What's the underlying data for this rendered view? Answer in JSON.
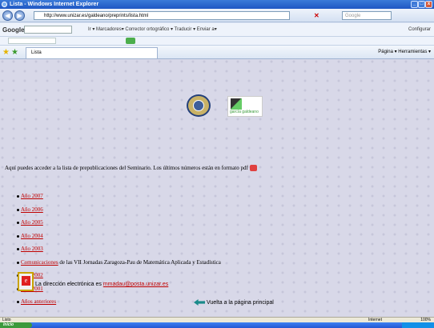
{
  "window": {
    "title": "Lista - Windows Internet Explorer"
  },
  "address": {
    "url": "http://www.unizar.es/galdeano/preprints/lista.html"
  },
  "search": {
    "placeholder": "Google"
  },
  "googlebar": {
    "logo": "Google",
    "items": "Ir ▾  Marcadores▾   Corrector ortográfico ▾   Traducir ▾   Enviar a▾",
    "settings": "Configurar"
  },
  "tab": {
    "title": "Lista"
  },
  "tools": "Página ▾  Herramientas ▾",
  "page": {
    "intro": "Aquí puedes acceder a la lista de prepublicaciones del Seminario. Los últimos números están en formato pdf",
    "logo2_text": "garcía galdeano",
    "list": [
      {
        "link": "Año 2007",
        "rest": ""
      },
      {
        "link": "Año 2006",
        "rest": ""
      },
      {
        "link": "Año 2005",
        "rest": ""
      },
      {
        "link": "Año 2004",
        "rest": ""
      },
      {
        "link": "Año 2003",
        "rest": ""
      },
      {
        "link": "Comunicaciones",
        "rest": " de las VII Jornadas Zaragoza-Pau de Matemática Aplicada y Estadística"
      },
      {
        "link": "Año 2002",
        "rest": ""
      },
      {
        "link": "Año 2001",
        "rest": ""
      },
      {
        "link": "Años anteriores",
        "rest": ""
      }
    ],
    "mail_prefix": "La dirección electrónica es ",
    "mail_link": "mmadau@posta.unizar.es",
    "back": "Vuelta a la página principal"
  },
  "status": {
    "left": "Listo",
    "zone": "Internet",
    "zoom": "100%"
  },
  "taskbar": {
    "start": "Inicio"
  }
}
